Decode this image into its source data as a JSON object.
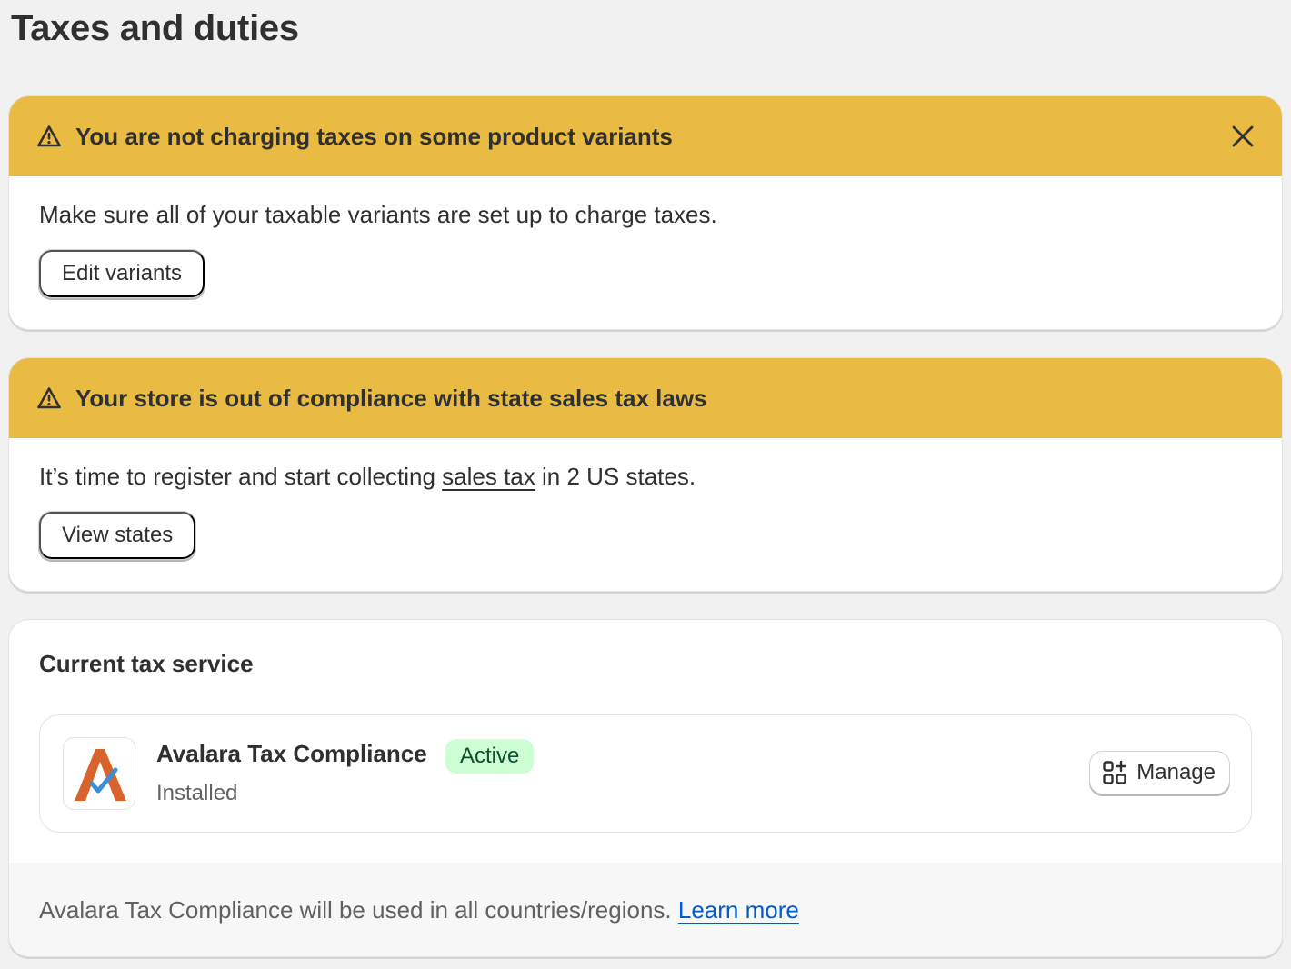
{
  "page": {
    "title": "Taxes and duties"
  },
  "banners": [
    {
      "title": "You are not charging taxes on some product variants",
      "body": "Make sure all of your taxable variants are set up to charge taxes.",
      "button_label": "Edit variants",
      "icon": "warning-icon",
      "dismissible": true,
      "close_icon": "close-icon"
    },
    {
      "title": "Your store is out of compliance with state sales tax laws",
      "body_before": "It’s time to register and start collecting ",
      "body_link": "sales tax",
      "body_after": " in 2 US states.",
      "button_label": "View states",
      "icon": "warning-icon",
      "dismissible": false
    }
  ],
  "tax_service": {
    "section_title": "Current tax service",
    "app": {
      "name": "Avalara Tax Compliance",
      "status_badge": "Active",
      "install_status": "Installed",
      "manage_label": "Manage",
      "manage_icon": "apps-icon",
      "logo": "avalara-logo"
    },
    "footer_text": "Avalara Tax Compliance will be used in all countries/regions. ",
    "footer_link": "Learn more"
  },
  "colors": {
    "banner_warning": "#eabb43",
    "badge_success_bg": "#cdfed4",
    "badge_success_text": "#0c5132",
    "link": "#005bd3",
    "logo_orange": "#d9632c",
    "logo_blue": "#3a8fd8"
  }
}
